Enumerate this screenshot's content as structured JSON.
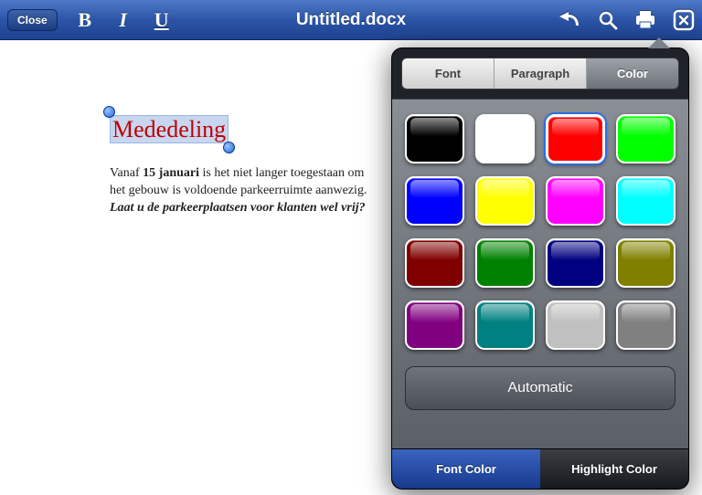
{
  "toolbar": {
    "close_label": "Close",
    "bold_label": "B",
    "italic_label": "I",
    "underline_label": "U",
    "title": "Untitled.docx"
  },
  "document": {
    "heading": "Mededeling",
    "line1_prefix": "Vanaf ",
    "line1_bold": "15 januari",
    "line1_suffix": " is het niet langer toegestaan om ",
    "line2": "het gebouw is voldoende parkeerruimte aanwezig.",
    "line3": "Laat u de parkeerplaatsen voor klanten wel vrij?"
  },
  "popover": {
    "tabs": {
      "font": "Font",
      "paragraph": "Paragraph",
      "color": "Color"
    },
    "colors": [
      {
        "name": "black",
        "hex": "#000000",
        "selected": false
      },
      {
        "name": "white",
        "hex": "#ffffff",
        "selected": false
      },
      {
        "name": "red",
        "hex": "#ff0000",
        "selected": true
      },
      {
        "name": "green",
        "hex": "#00ff00",
        "selected": false
      },
      {
        "name": "blue",
        "hex": "#0000ff",
        "selected": false
      },
      {
        "name": "yellow",
        "hex": "#ffff00",
        "selected": false
      },
      {
        "name": "magenta",
        "hex": "#ff00ff",
        "selected": false
      },
      {
        "name": "cyan",
        "hex": "#00ffff",
        "selected": false
      },
      {
        "name": "darkred",
        "hex": "#800000",
        "selected": false
      },
      {
        "name": "darkgreen",
        "hex": "#008000",
        "selected": false
      },
      {
        "name": "navy",
        "hex": "#000080",
        "selected": false
      },
      {
        "name": "olive",
        "hex": "#808000",
        "selected": false
      },
      {
        "name": "purple",
        "hex": "#800080",
        "selected": false
      },
      {
        "name": "teal",
        "hex": "#008080",
        "selected": false
      },
      {
        "name": "silver",
        "hex": "#c0c0c0",
        "selected": false
      },
      {
        "name": "gray",
        "hex": "#808080",
        "selected": false
      }
    ],
    "automatic_label": "Automatic",
    "bottom": {
      "font_color": "Font Color",
      "highlight_color": "Highlight Color"
    }
  }
}
